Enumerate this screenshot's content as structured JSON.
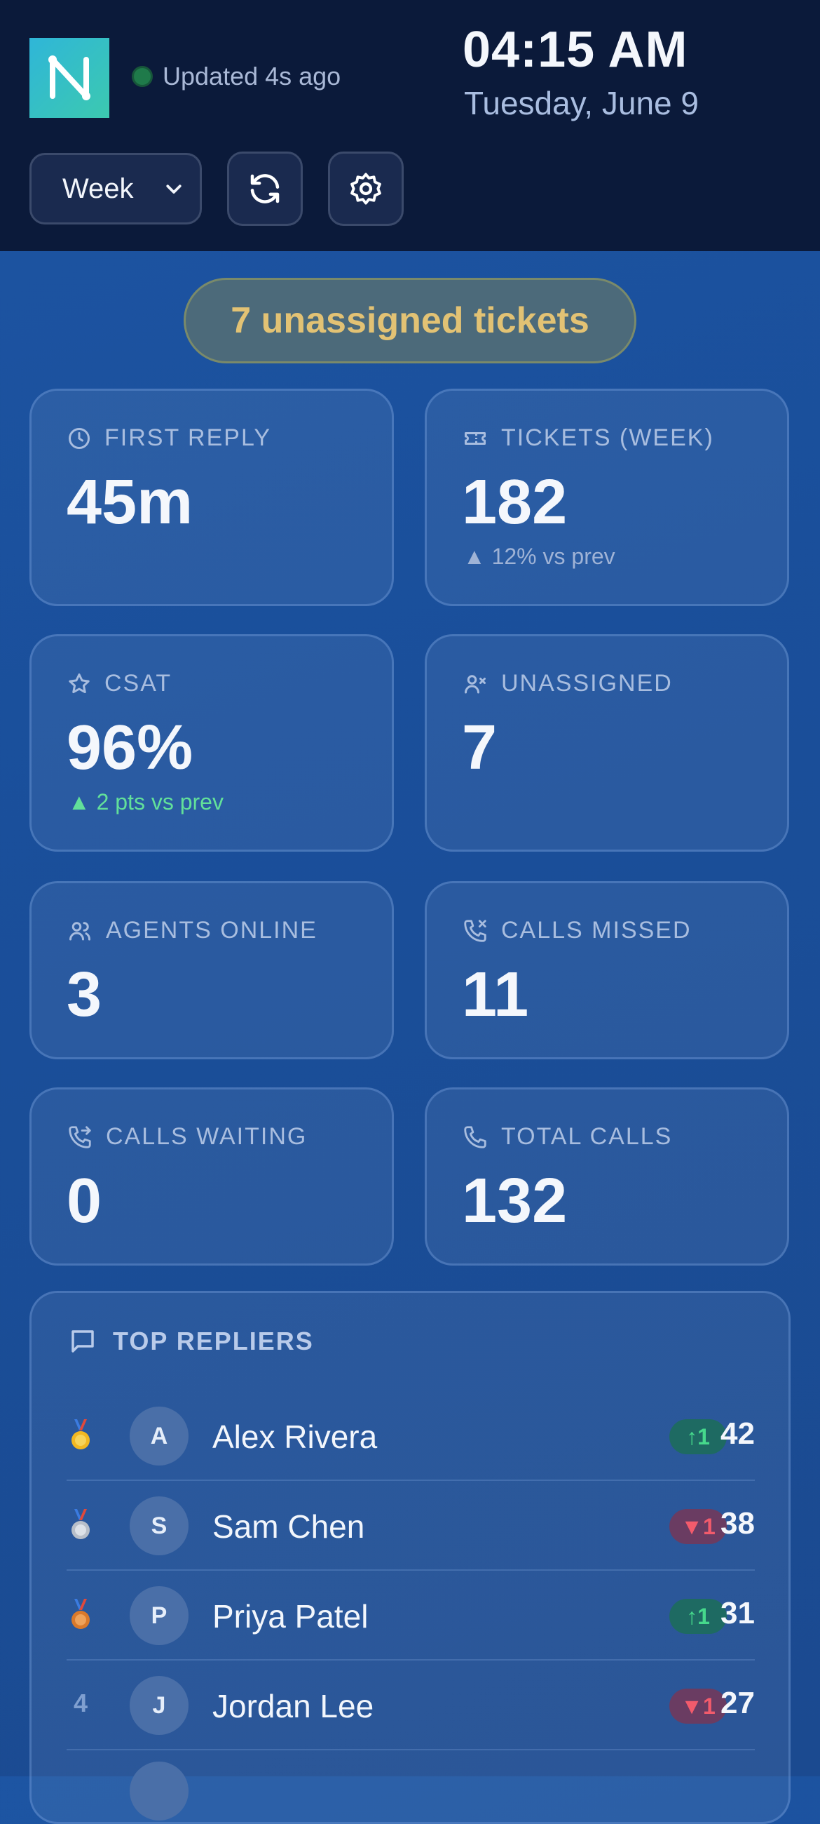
{
  "header": {
    "logo_letter": "N",
    "status_text": "Updated 4s ago",
    "status_color": "#1f7a4a",
    "clock": "04:15 AM",
    "date": "Tuesday, June 9",
    "period_select": {
      "selected": "Week"
    },
    "refresh_icon": "refresh-icon",
    "settings_icon": "gear-icon"
  },
  "alert": {
    "text": "7 unassigned tickets",
    "color": "#e2c274"
  },
  "metrics": [
    {
      "icon": "clock-icon",
      "label": "FIRST REPLY",
      "value": "45m",
      "sub": ""
    },
    {
      "icon": "ticket-icon",
      "label": "TICKETS (WEEK)",
      "value": "182",
      "sub": "▲ 12% vs prev"
    },
    {
      "icon": "star-icon",
      "label": "CSAT",
      "value": "96%",
      "sub": "▲ 2 pts vs prev"
    },
    {
      "icon": "user-x-icon",
      "label": "UNASSIGNED",
      "value": "7",
      "sub": ""
    },
    {
      "icon": "users-icon",
      "label": "AGENTS ONLINE",
      "value": "3",
      "sub": ""
    },
    {
      "icon": "phone-missed-icon",
      "label": "CALLS MISSED",
      "value": "11",
      "sub": ""
    },
    {
      "icon": "phone-forward-icon",
      "label": "CALLS WAITING",
      "value": "0",
      "sub": ""
    },
    {
      "icon": "phone-icon",
      "label": "TOTAL CALLS",
      "value": "132",
      "sub": ""
    }
  ],
  "leaderboard": {
    "title": "TOP REPLIERS",
    "icon": "message-square-icon",
    "rows": [
      {
        "rank": "",
        "medal": "gold-medal-icon",
        "initial": "A",
        "name": "Alex Rivera",
        "delta": "↑1",
        "trend": "up",
        "count": "42"
      },
      {
        "rank": "",
        "medal": "silver-medal-icon",
        "initial": "S",
        "name": "Sam Chen",
        "delta": "▼1",
        "trend": "down",
        "count": "38"
      },
      {
        "rank": "",
        "medal": "bronze-medal-icon",
        "initial": "P",
        "name": "Priya Patel",
        "delta": "↑1",
        "trend": "up",
        "count": "31"
      },
      {
        "rank": "4",
        "medal": "",
        "initial": "J",
        "name": "Jordan Lee",
        "delta": "▼1",
        "trend": "down",
        "count": "27"
      }
    ]
  }
}
